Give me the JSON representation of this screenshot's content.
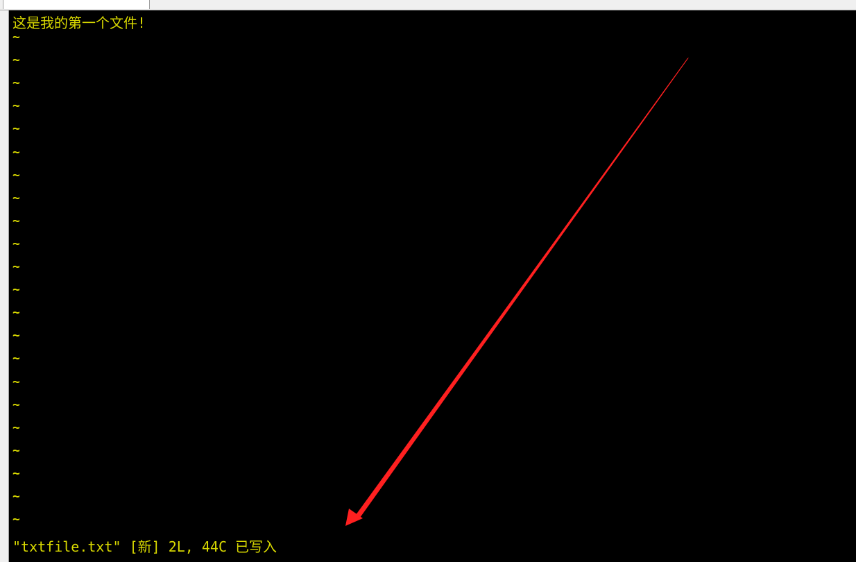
{
  "editor": {
    "first_line": "这是我的第一个文件!",
    "tilde_marker": "~",
    "tilde_count": 22,
    "status_line": "\"txtfile.txt\" [新] 2L, 44C 已写入"
  },
  "colors": {
    "terminal_bg": "#000000",
    "text": "#d9d900",
    "annotation_arrow": "#ff2020"
  }
}
